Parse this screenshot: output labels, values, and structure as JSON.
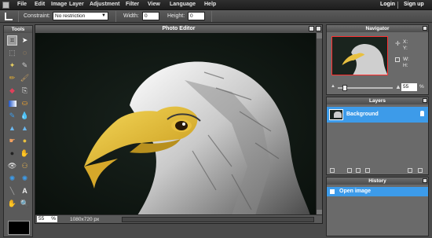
{
  "menubar": {
    "items": [
      "File",
      "Edit",
      "Image",
      "Layer",
      "Adjustment",
      "Filter",
      "View",
      "Language",
      "Help"
    ],
    "login": "Login",
    "signup": "Sign up"
  },
  "options": {
    "constraint_label": "Constraint:",
    "constraint_value": "No restriction",
    "width_label": "Width:",
    "width_value": "0",
    "height_label": "Height:",
    "height_value": "0"
  },
  "tools": {
    "title": "Tools"
  },
  "editor": {
    "title": "Photo Editor",
    "zoom": "55",
    "zoom_unit": "%",
    "dimensions": "1080x720 px"
  },
  "navigator": {
    "title": "Navigator",
    "x_label": "X:",
    "y_label": "Y:",
    "w_label": "W:",
    "h_label": "H:",
    "zoom": "55",
    "zoom_unit": "%"
  },
  "layers": {
    "title": "Layers",
    "items": [
      "Background"
    ]
  },
  "history": {
    "title": "History",
    "items": [
      "Open image"
    ]
  },
  "colors": {
    "accent": "#3d9be9",
    "foreground": "#000000"
  }
}
